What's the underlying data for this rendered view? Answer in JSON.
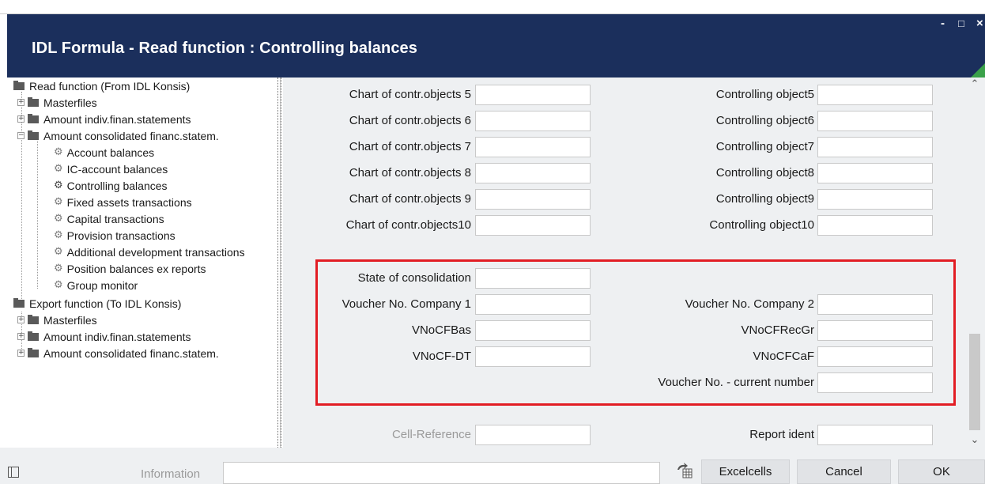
{
  "window": {
    "title": "IDL Formula  - Read function : Controlling balances",
    "controls": {
      "minimize": "-",
      "maximize": "□",
      "close": "×"
    }
  },
  "tree": {
    "items": [
      {
        "label": "Read function (From IDL Konsis)",
        "icon": "folder-icon",
        "level": 0
      },
      {
        "label": "Masterfiles",
        "icon": "folder-icon",
        "level": 1,
        "expander": "+"
      },
      {
        "label": "Amount indiv.finan.statements",
        "icon": "folder-icon",
        "level": 1,
        "expander": "+"
      },
      {
        "label": "Amount consolidated financ.statem.",
        "icon": "folder-icon",
        "level": 1,
        "expander": "−"
      },
      {
        "label": "Account balances",
        "icon": "gear-icon",
        "level": 2
      },
      {
        "label": "IC-account balances",
        "icon": "gear-icon",
        "level": 2
      },
      {
        "label": "Controlling balances",
        "icon": "gear-icon",
        "level": 2,
        "selected": true
      },
      {
        "label": "Fixed assets transactions",
        "icon": "gear-icon",
        "level": 2
      },
      {
        "label": "Capital transactions",
        "icon": "gear-icon",
        "level": 2
      },
      {
        "label": "Provision transactions",
        "icon": "gear-icon",
        "level": 2
      },
      {
        "label": "Additional development transactions",
        "icon": "gear-icon",
        "level": 2
      },
      {
        "label": "Position balances ex reports",
        "icon": "gear-icon",
        "level": 2
      },
      {
        "label": "Group monitor",
        "icon": "gear-icon",
        "level": 2
      },
      {
        "label": "Export function (To IDL Konsis)",
        "icon": "folder-icon",
        "level": 0
      },
      {
        "label": "Masterfiles",
        "icon": "folder-icon",
        "level": 1,
        "expander": "+"
      },
      {
        "label": "Amount indiv.finan.statements",
        "icon": "folder-icon",
        "level": 1,
        "expander": "+"
      },
      {
        "label": "Amount consolidated financ.statem.",
        "icon": "folder-icon",
        "level": 1,
        "expander": "+"
      }
    ]
  },
  "form": {
    "left_labels": [
      "Chart of contr.objects 5",
      "Chart of contr.objects 6",
      "Chart of contr.objects 7",
      "Chart of contr.objects 8",
      "Chart of contr.objects 9",
      "Chart of contr.objects10"
    ],
    "right_labels": [
      "Controlling object5",
      "Controlling object6",
      "Controlling object7",
      "Controlling object8",
      "Controlling object9",
      "Controlling object10"
    ],
    "voucher": {
      "state_of_consolidation": "State of consolidation",
      "voucher_company_1": "Voucher No. Company 1",
      "voucher_company_2": "Voucher No. Company 2",
      "vnocfbas": "VNoCFBas",
      "vnocfrecgr": "VNoCFRecGr",
      "vnocf_dt": "VNoCF-DT",
      "vnocfcaf": "VNoCFCaF",
      "current_number": "Voucher No. - current number"
    },
    "cell_reference": "Cell-Reference",
    "report_ident": "Report ident",
    "highlight_color": "#e21d24"
  },
  "bottom": {
    "information_label": "Information",
    "information_value": "",
    "buttons": {
      "excelcells": "Excelcells",
      "cancel": "Cancel",
      "ok": "OK"
    }
  },
  "colors": {
    "titlebar": "#1b2f5c",
    "form_bg": "#eef0f2",
    "accent_triangle": "#3aa14a"
  }
}
